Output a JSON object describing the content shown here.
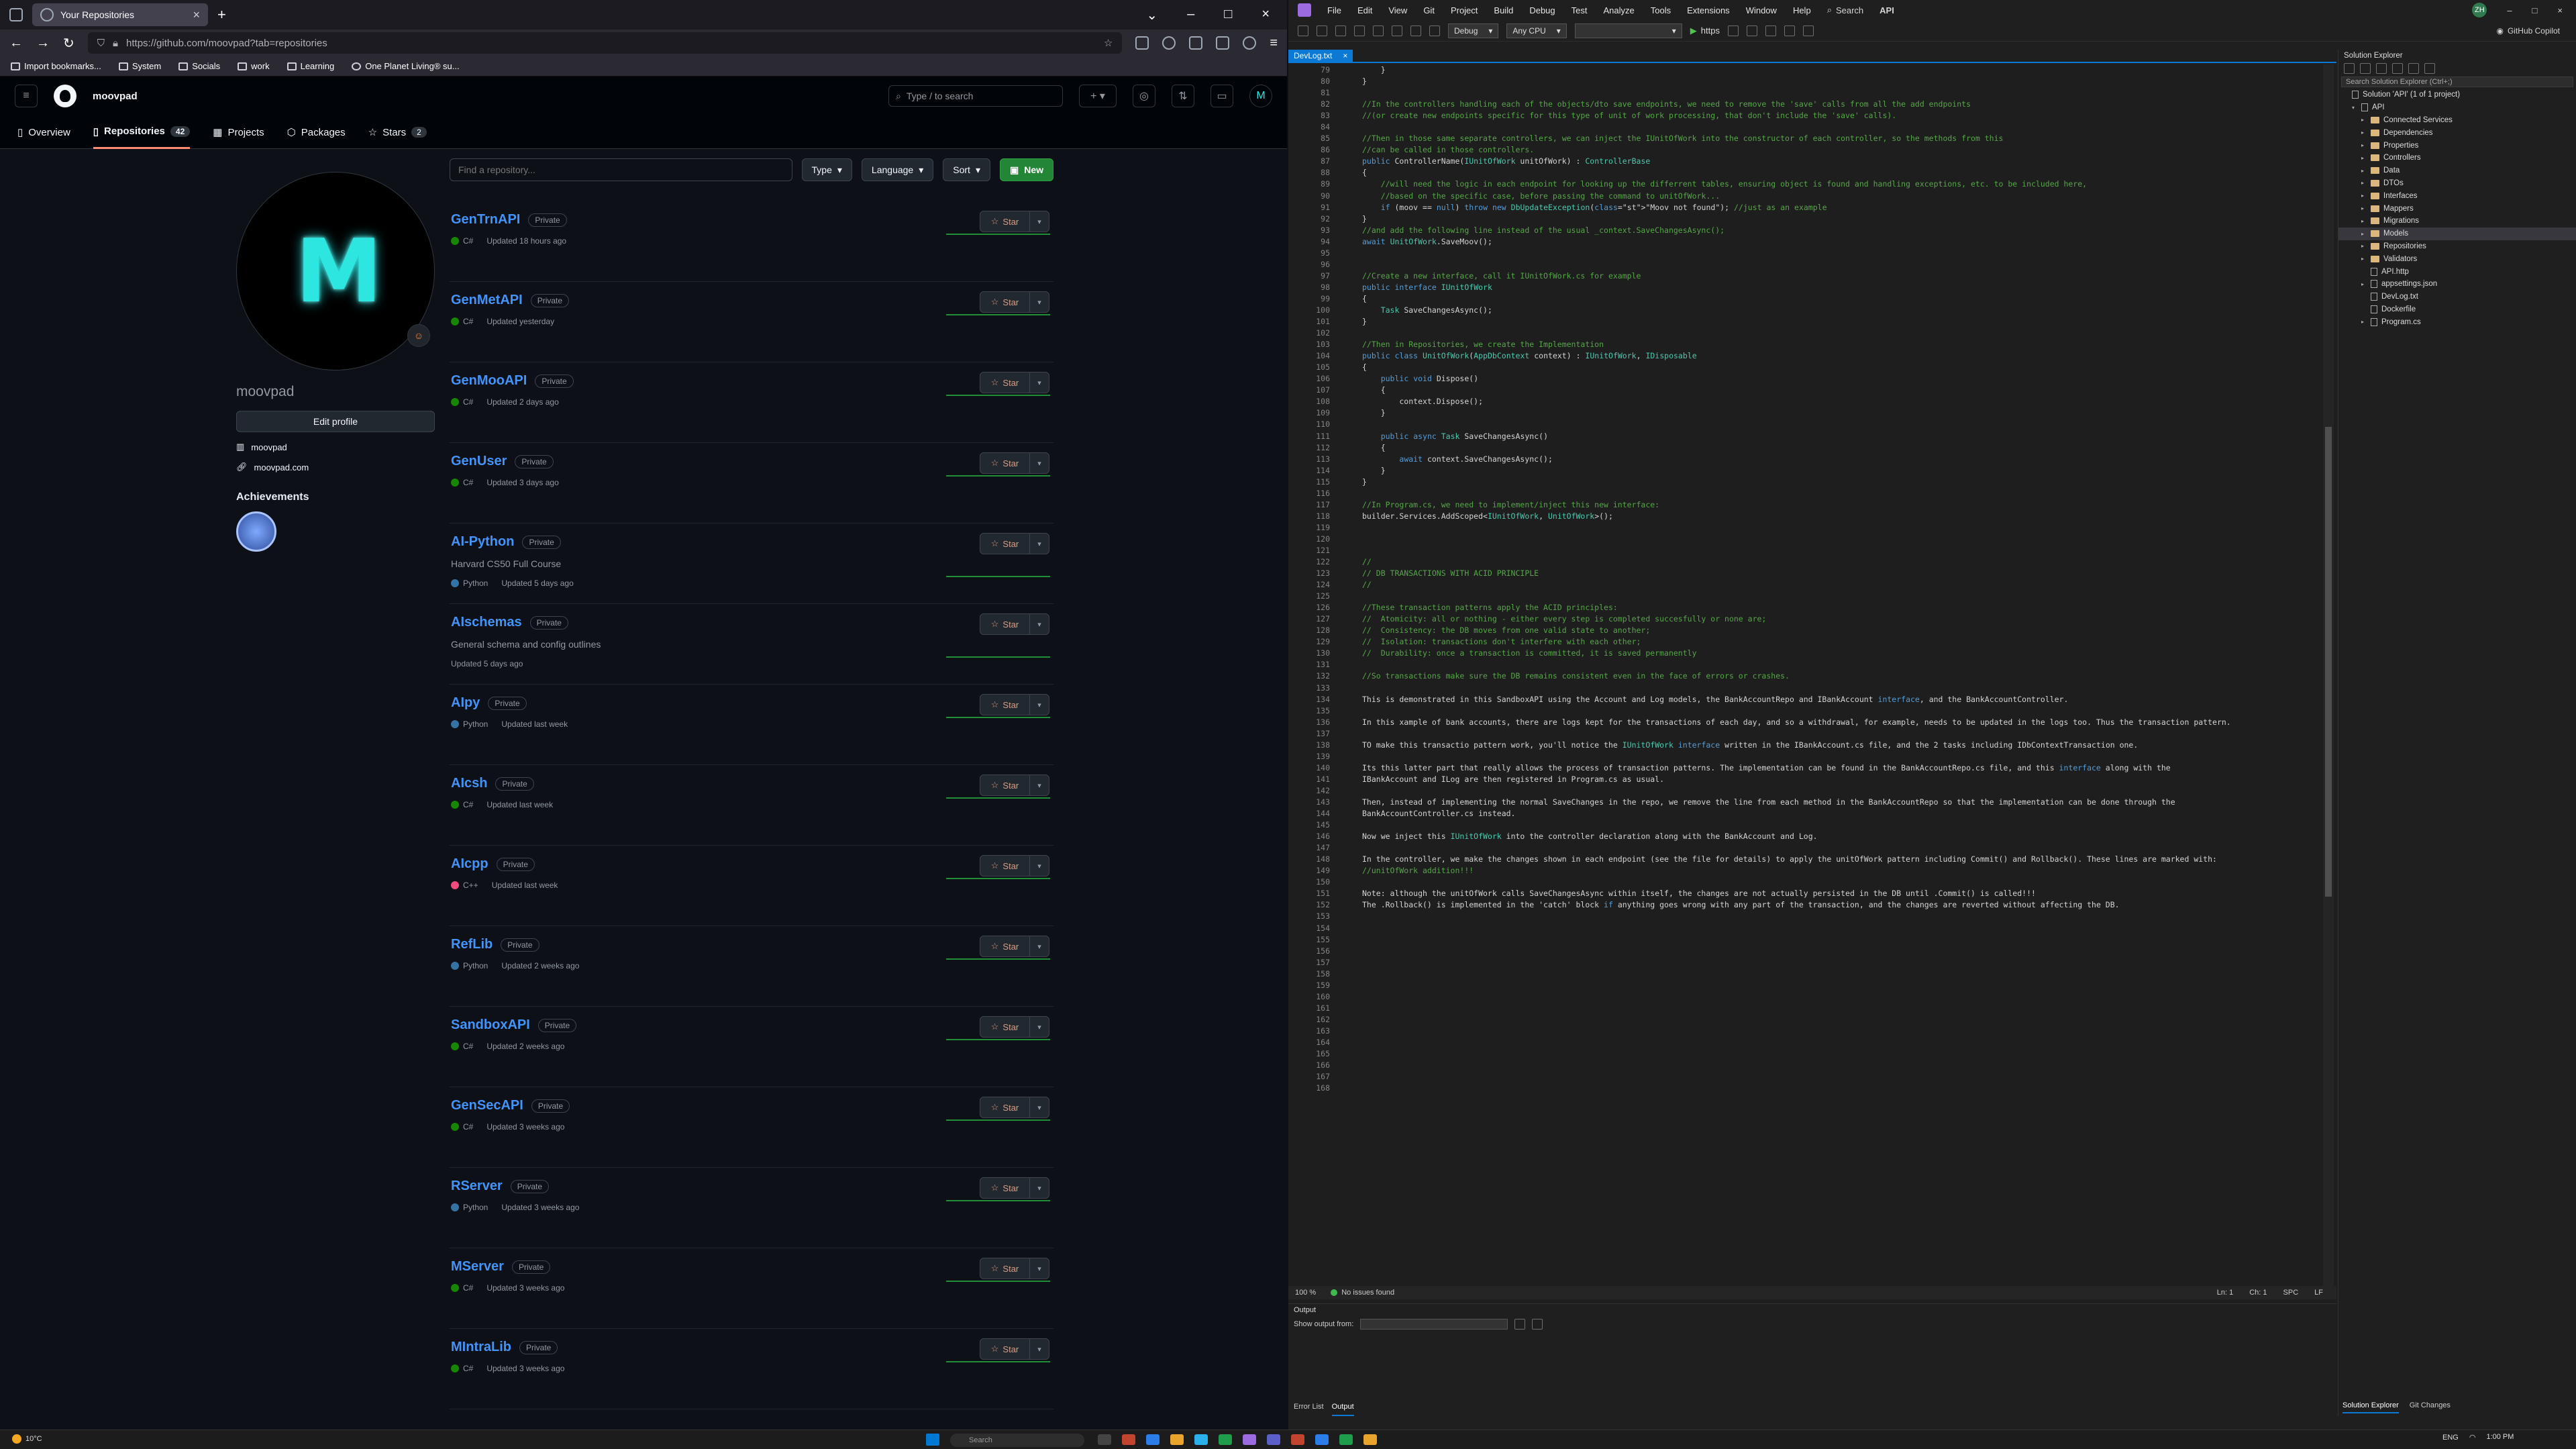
{
  "browser": {
    "tab_title": "Your Repositories",
    "url": "https://github.com/moovpad?tab=repositories",
    "bookmarks": [
      "Import bookmarks...",
      "System",
      "Socials",
      "work",
      "Learning",
      "One Planet Living® su..."
    ]
  },
  "github": {
    "username": "moovpad",
    "search_placeholder": "Type / to search",
    "tabs": [
      {
        "label": "Overview",
        "count": ""
      },
      {
        "label": "Repositories",
        "count": "42"
      },
      {
        "label": "Projects",
        "count": ""
      },
      {
        "label": "Packages",
        "count": ""
      },
      {
        "label": "Stars",
        "count": "2"
      }
    ],
    "profile": {
      "avatar_text": "M",
      "login": "moovpad",
      "edit_label": "Edit profile",
      "meta": [
        "moovpad",
        "moovpad.com"
      ],
      "achievements_label": "Achievements"
    },
    "find_placeholder": "Find a repository...",
    "filters": [
      "Type",
      "Language",
      "Sort"
    ],
    "new_label": "New",
    "star_label": "Star",
    "repos": [
      {
        "name": "GenTrnAPI",
        "vis": "Private",
        "desc": "",
        "lang": "C#",
        "lang_color": "#178600",
        "updated": "Updated 18 hours ago"
      },
      {
        "name": "GenMetAPI",
        "vis": "Private",
        "desc": "",
        "lang": "C#",
        "lang_color": "#178600",
        "updated": "Updated yesterday"
      },
      {
        "name": "GenMooAPI",
        "vis": "Private",
        "desc": "",
        "lang": "C#",
        "lang_color": "#178600",
        "updated": "Updated 2 days ago"
      },
      {
        "name": "GenUser",
        "vis": "Private",
        "desc": "",
        "lang": "C#",
        "lang_color": "#178600",
        "updated": "Updated 3 days ago"
      },
      {
        "name": "AI-Python",
        "vis": "Private",
        "desc": "Harvard CS50 Full Course",
        "lang": "Python",
        "lang_color": "#3572A5",
        "updated": "Updated 5 days ago"
      },
      {
        "name": "AIschemas",
        "vis": "Private",
        "desc": "General schema and config outlines",
        "lang": "",
        "lang_color": "",
        "updated": "Updated 5 days ago"
      },
      {
        "name": "AIpy",
        "vis": "Private",
        "desc": "",
        "lang": "Python",
        "lang_color": "#3572A5",
        "updated": "Updated last week"
      },
      {
        "name": "AIcsh",
        "vis": "Private",
        "desc": "",
        "lang": "C#",
        "lang_color": "#178600",
        "updated": "Updated last week"
      },
      {
        "name": "AIcpp",
        "vis": "Private",
        "desc": "",
        "lang": "C++",
        "lang_color": "#f34b7d",
        "updated": "Updated last week"
      },
      {
        "name": "RefLib",
        "vis": "Private",
        "desc": "",
        "lang": "Python",
        "lang_color": "#3572A5",
        "updated": "Updated 2 weeks ago"
      },
      {
        "name": "SandboxAPI",
        "vis": "Private",
        "desc": "",
        "lang": "C#",
        "lang_color": "#178600",
        "updated": "Updated 2 weeks ago"
      },
      {
        "name": "GenSecAPI",
        "vis": "Private",
        "desc": "",
        "lang": "C#",
        "lang_color": "#178600",
        "updated": "Updated 3 weeks ago"
      },
      {
        "name": "RServer",
        "vis": "Private",
        "desc": "",
        "lang": "Python",
        "lang_color": "#3572A5",
        "updated": "Updated 3 weeks ago"
      },
      {
        "name": "MServer",
        "vis": "Private",
        "desc": "",
        "lang": "C#",
        "lang_color": "#178600",
        "updated": "Updated 3 weeks ago"
      },
      {
        "name": "MIntraLib",
        "vis": "Private",
        "desc": "",
        "lang": "C#",
        "lang_color": "#178600",
        "updated": "Updated 3 weeks ago"
      }
    ]
  },
  "vs": {
    "menu": [
      "File",
      "Edit",
      "View",
      "Git",
      "Project",
      "Build",
      "Debug",
      "Test",
      "Analyze",
      "Tools",
      "Extensions",
      "Window",
      "Help"
    ],
    "search": "Search",
    "solution": "API",
    "avatar": "ZH",
    "config": "Debug",
    "platform": "Any CPU",
    "run": "https",
    "copilot": "GitHub Copilot",
    "doc_tab": "DevLog.txt",
    "first_line": 79,
    "lines": [
      "    }",
      "}",
      "",
      "//In the controllers handling each of the objects/dto save endpoints, we need to remove the 'save' calls from all the add endpoints",
      "//(or create new endpoints specific for this type of unit of work processing, that don't include the 'save' calls).",
      "",
      "//Then in those same separate controllers, we can inject the IUnitOfWork into the constructor of each controller, so the methods from this",
      "//can be called in those controllers.",
      "public ControllerName(IUnitOfWork unitOfWork) : ControllerBase",
      "{",
      "    //will need the logic in each endpoint for looking up the differrent tables, ensuring object is found and handling exceptions, etc. to be included here,",
      "    //based on the specific case, before passing the command to unitOfWork...",
      "    if (moov == null) throw new DbUpdateException(\"Moov not found\"); //just as an example",
      "}",
      "//and add the following line instead of the usual _context.SaveChangesAsync();",
      "await UnitOfWork.SaveMoov();",
      "",
      "",
      "//Create a new interface, call it IUnitOfWork.cs for example",
      "public interface IUnitOfWork",
      "{",
      "    Task SaveChangesAsync();",
      "}",
      "",
      "//Then in Repositories, we create the Implementation",
      "public class UnitOfWork(AppDbContext context) : IUnitOfWork, IDisposable",
      "{",
      "    public void Dispose()",
      "    {",
      "        context.Dispose();",
      "    }",
      "",
      "    public async Task SaveChangesAsync()",
      "    {",
      "        await context.SaveChangesAsync();",
      "    }",
      "}",
      "",
      "//In Program.cs, we need to implement/inject this new interface:",
      "builder.Services.AddScoped<IUnitOfWork, UnitOfWork>();",
      "",
      "",
      "",
      "//",
      "// DB TRANSACTIONS WITH ACID PRINCIPLE",
      "//",
      "",
      "//These transaction patterns apply the ACID principles:",
      "//  Atomicity: all or nothing - either every step is completed succesfully or none are;",
      "//  Consistency: the DB moves from one valid state to another;",
      "//  Isolation: transactions don't interfere with each other;",
      "//  Durability: once a transaction is committed, it is saved permanently",
      "",
      "//So transactions make sure the DB remains consistent even in the face of errors or crashes.",
      "",
      "This is demonstrated in this SandboxAPI using the Account and Log models, the BankAccountRepo and IBankAccount interface, and the BankAccountController.",
      "",
      "In this xample of bank accounts, there are logs kept for the transactions of each day, and so a withdrawal, for example, needs to be updated in the logs too. Thus the transaction pattern.",
      "",
      "TO make this transactio pattern work, you'll notice the IUnitOfWork interface written in the IBankAccount.cs file, and the 2 tasks including IDbContextTransaction one.",
      "",
      "Its this latter part that really allows the process of transaction patterns. The implementation can be found in the BankAccountRepo.cs file, and this interface along with the",
      "IBankAccount and ILog are then registered in Program.cs as usual.",
      "",
      "Then, instead of implementing the normal SaveChanges in the repo, we remove the line from each method in the BankAccountRepo so that the implementation can be done through the",
      "BankAccountController.cs instead.",
      "",
      "Now we inject this IUnitOfWork into the controller declaration along with the BankAccount and Log.",
      "",
      "In the controller, we make the changes shown in each endpoint (see the file for details) to apply the unitOfWork pattern including Commit() and Rollback(). These lines are marked with:",
      "//unitOfWork addition!!!",
      "",
      "Note: although the unitOfWork calls SaveChangesAsync within itself, the changes are not actually persisted in the DB until .Commit() is called!!!",
      "The .Rollback() is implemented in the 'catch' block if anything goes wrong with any part of the transaction, and the changes are reverted without affecting the DB.",
      "",
      "",
      "",
      "",
      "",
      "",
      "",
      "",
      "",
      "",
      "",
      "",
      "",
      "",
      "",
      ""
    ],
    "status": {
      "zoom": "100 %",
      "issues": "No issues found",
      "ln": "Ln: 1",
      "ch": "Ch: 1",
      "spc": "SPC",
      "eol": "LF"
    },
    "output": {
      "title": "Output",
      "show_from": "Show output from:",
      "tabs": [
        "Error List",
        "Output"
      ]
    },
    "solution_explorer": {
      "title": "Solution Explorer",
      "search": "Search Solution Explorer (Ctrl+;)",
      "items": [
        {
          "label": "Solution 'API' (1 of 1 project)",
          "indent": 0,
          "kind": "file",
          "caret": ""
        },
        {
          "label": "API",
          "indent": 1,
          "kind": "file",
          "caret": "▾"
        },
        {
          "label": "Connected Services",
          "indent": 2,
          "kind": "folder",
          "caret": "▸"
        },
        {
          "label": "Dependencies",
          "indent": 2,
          "kind": "folder",
          "caret": "▸"
        },
        {
          "label": "Properties",
          "indent": 2,
          "kind": "folder",
          "caret": "▸"
        },
        {
          "label": "Controllers",
          "indent": 2,
          "kind": "folder",
          "caret": "▸"
        },
        {
          "label": "Data",
          "indent": 2,
          "kind": "folder",
          "caret": "▸"
        },
        {
          "label": "DTOs",
          "indent": 2,
          "kind": "folder",
          "caret": "▸"
        },
        {
          "label": "Interfaces",
          "indent": 2,
          "kind": "folder",
          "caret": "▸"
        },
        {
          "label": "Mappers",
          "indent": 2,
          "kind": "folder",
          "caret": "▸"
        },
        {
          "label": "Migrations",
          "indent": 2,
          "kind": "folder",
          "caret": "▸"
        },
        {
          "label": "Models",
          "indent": 2,
          "kind": "folder",
          "caret": "▸"
        },
        {
          "label": "Repositories",
          "indent": 2,
          "kind": "folder",
          "caret": "▸"
        },
        {
          "label": "Validators",
          "indent": 2,
          "kind": "folder",
          "caret": "▸"
        },
        {
          "label": "API.http",
          "indent": 2,
          "kind": "file",
          "caret": ""
        },
        {
          "label": "appsettings.json",
          "indent": 2,
          "kind": "file",
          "caret": "▸"
        },
        {
          "label": "DevLog.txt",
          "indent": 2,
          "kind": "file",
          "caret": ""
        },
        {
          "label": "Dockerfile",
          "indent": 2,
          "kind": "file",
          "caret": ""
        },
        {
          "label": "Program.cs",
          "indent": 2,
          "kind": "file",
          "caret": "▸"
        }
      ],
      "tabs": [
        "Solution Explorer",
        "Git Changes"
      ]
    }
  },
  "taskbar": {
    "temp": "10°C",
    "search": "Search",
    "lang": "ENG",
    "time": "1:00 PM"
  }
}
